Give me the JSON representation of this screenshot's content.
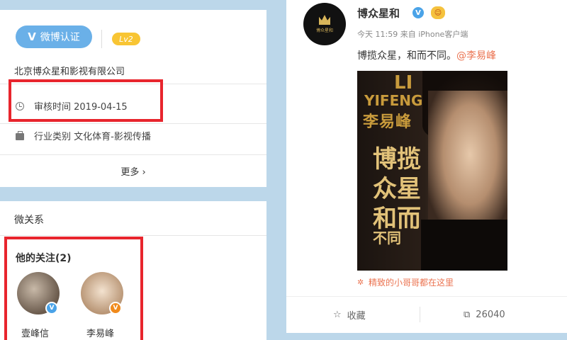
{
  "profile_card": {
    "verify_label": "微博认证",
    "level": "Lv2",
    "company": "北京博众星和影视有限公司",
    "review_time": "审核时间 2019-04-15",
    "industry": "行业类别 文化体育-影视传播",
    "more_label": "更多"
  },
  "relations": {
    "title": "微关系",
    "following_title": "他的关注(2)",
    "following": [
      {
        "name": "壹峰信",
        "badge": "V"
      },
      {
        "name": "李易峰",
        "badge": "V"
      }
    ]
  },
  "post": {
    "author": "博众星和",
    "meta": "今天 11:59 来自 iPhone客户端",
    "text": "博揽众星，和而不同。",
    "mention": "@李易峰",
    "avatar_text": "博众星和",
    "poster_lines": [
      "LI",
      "YIFENG",
      "李易峰",
      "博揽",
      "众星",
      "和而",
      "不同"
    ],
    "tag_text": "精致的小哥哥都在这里",
    "favorite_label": "收藏",
    "share_count": "26040"
  },
  "colors": {
    "background": "#bcd7ea",
    "highlight_box": "#e8252d",
    "verify_blue": "#6ab0e8",
    "link_orange": "#eb7350"
  }
}
